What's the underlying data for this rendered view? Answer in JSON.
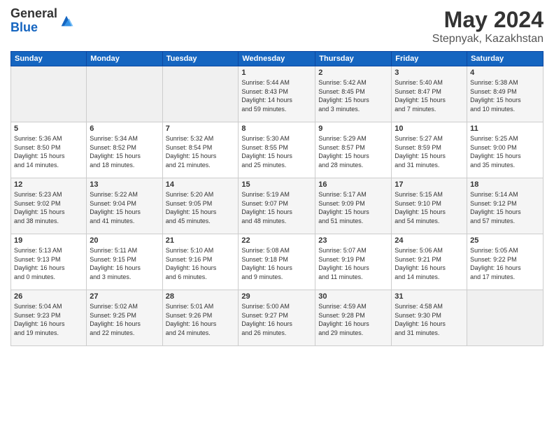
{
  "logo": {
    "general": "General",
    "blue": "Blue"
  },
  "header": {
    "month": "May 2024",
    "location": "Stepnyak, Kazakhstan"
  },
  "days_of_week": [
    "Sunday",
    "Monday",
    "Tuesday",
    "Wednesday",
    "Thursday",
    "Friday",
    "Saturday"
  ],
  "weeks": [
    [
      {
        "day": "",
        "info": ""
      },
      {
        "day": "",
        "info": ""
      },
      {
        "day": "",
        "info": ""
      },
      {
        "day": "1",
        "info": "Sunrise: 5:44 AM\nSunset: 8:43 PM\nDaylight: 14 hours\nand 59 minutes."
      },
      {
        "day": "2",
        "info": "Sunrise: 5:42 AM\nSunset: 8:45 PM\nDaylight: 15 hours\nand 3 minutes."
      },
      {
        "day": "3",
        "info": "Sunrise: 5:40 AM\nSunset: 8:47 PM\nDaylight: 15 hours\nand 7 minutes."
      },
      {
        "day": "4",
        "info": "Sunrise: 5:38 AM\nSunset: 8:49 PM\nDaylight: 15 hours\nand 10 minutes."
      }
    ],
    [
      {
        "day": "5",
        "info": "Sunrise: 5:36 AM\nSunset: 8:50 PM\nDaylight: 15 hours\nand 14 minutes."
      },
      {
        "day": "6",
        "info": "Sunrise: 5:34 AM\nSunset: 8:52 PM\nDaylight: 15 hours\nand 18 minutes."
      },
      {
        "day": "7",
        "info": "Sunrise: 5:32 AM\nSunset: 8:54 PM\nDaylight: 15 hours\nand 21 minutes."
      },
      {
        "day": "8",
        "info": "Sunrise: 5:30 AM\nSunset: 8:55 PM\nDaylight: 15 hours\nand 25 minutes."
      },
      {
        "day": "9",
        "info": "Sunrise: 5:29 AM\nSunset: 8:57 PM\nDaylight: 15 hours\nand 28 minutes."
      },
      {
        "day": "10",
        "info": "Sunrise: 5:27 AM\nSunset: 8:59 PM\nDaylight: 15 hours\nand 31 minutes."
      },
      {
        "day": "11",
        "info": "Sunrise: 5:25 AM\nSunset: 9:00 PM\nDaylight: 15 hours\nand 35 minutes."
      }
    ],
    [
      {
        "day": "12",
        "info": "Sunrise: 5:23 AM\nSunset: 9:02 PM\nDaylight: 15 hours\nand 38 minutes."
      },
      {
        "day": "13",
        "info": "Sunrise: 5:22 AM\nSunset: 9:04 PM\nDaylight: 15 hours\nand 41 minutes."
      },
      {
        "day": "14",
        "info": "Sunrise: 5:20 AM\nSunset: 9:05 PM\nDaylight: 15 hours\nand 45 minutes."
      },
      {
        "day": "15",
        "info": "Sunrise: 5:19 AM\nSunset: 9:07 PM\nDaylight: 15 hours\nand 48 minutes."
      },
      {
        "day": "16",
        "info": "Sunrise: 5:17 AM\nSunset: 9:09 PM\nDaylight: 15 hours\nand 51 minutes."
      },
      {
        "day": "17",
        "info": "Sunrise: 5:15 AM\nSunset: 9:10 PM\nDaylight: 15 hours\nand 54 minutes."
      },
      {
        "day": "18",
        "info": "Sunrise: 5:14 AM\nSunset: 9:12 PM\nDaylight: 15 hours\nand 57 minutes."
      }
    ],
    [
      {
        "day": "19",
        "info": "Sunrise: 5:13 AM\nSunset: 9:13 PM\nDaylight: 16 hours\nand 0 minutes."
      },
      {
        "day": "20",
        "info": "Sunrise: 5:11 AM\nSunset: 9:15 PM\nDaylight: 16 hours\nand 3 minutes."
      },
      {
        "day": "21",
        "info": "Sunrise: 5:10 AM\nSunset: 9:16 PM\nDaylight: 16 hours\nand 6 minutes."
      },
      {
        "day": "22",
        "info": "Sunrise: 5:08 AM\nSunset: 9:18 PM\nDaylight: 16 hours\nand 9 minutes."
      },
      {
        "day": "23",
        "info": "Sunrise: 5:07 AM\nSunset: 9:19 PM\nDaylight: 16 hours\nand 11 minutes."
      },
      {
        "day": "24",
        "info": "Sunrise: 5:06 AM\nSunset: 9:21 PM\nDaylight: 16 hours\nand 14 minutes."
      },
      {
        "day": "25",
        "info": "Sunrise: 5:05 AM\nSunset: 9:22 PM\nDaylight: 16 hours\nand 17 minutes."
      }
    ],
    [
      {
        "day": "26",
        "info": "Sunrise: 5:04 AM\nSunset: 9:23 PM\nDaylight: 16 hours\nand 19 minutes."
      },
      {
        "day": "27",
        "info": "Sunrise: 5:02 AM\nSunset: 9:25 PM\nDaylight: 16 hours\nand 22 minutes."
      },
      {
        "day": "28",
        "info": "Sunrise: 5:01 AM\nSunset: 9:26 PM\nDaylight: 16 hours\nand 24 minutes."
      },
      {
        "day": "29",
        "info": "Sunrise: 5:00 AM\nSunset: 9:27 PM\nDaylight: 16 hours\nand 26 minutes."
      },
      {
        "day": "30",
        "info": "Sunrise: 4:59 AM\nSunset: 9:28 PM\nDaylight: 16 hours\nand 29 minutes."
      },
      {
        "day": "31",
        "info": "Sunrise: 4:58 AM\nSunset: 9:30 PM\nDaylight: 16 hours\nand 31 minutes."
      },
      {
        "day": "",
        "info": ""
      }
    ]
  ]
}
